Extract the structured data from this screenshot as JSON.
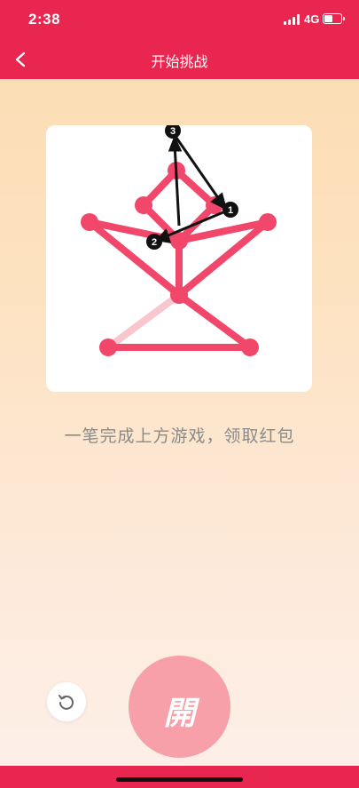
{
  "status_bar": {
    "time": "2:38",
    "network": "4G"
  },
  "nav": {
    "title": "开始挑战",
    "back_icon": "chevron-left-icon"
  },
  "game": {
    "nodes": [
      "n1",
      "n2",
      "n3",
      "n4",
      "n5",
      "n6",
      "n7",
      "n8",
      "n9"
    ],
    "path_step_labels": [
      "1",
      "2",
      "3"
    ],
    "line_color": "#f0476a",
    "used_segment_color": "#f9c6ce",
    "arrow_color": "#111111"
  },
  "instruction": "一笔完成上方游戏，领取红包",
  "controls": {
    "refresh_icon": "refresh-icon",
    "open_label": "開"
  },
  "colors": {
    "accent": "#e8264f",
    "open_button": "#f7a0aa"
  }
}
